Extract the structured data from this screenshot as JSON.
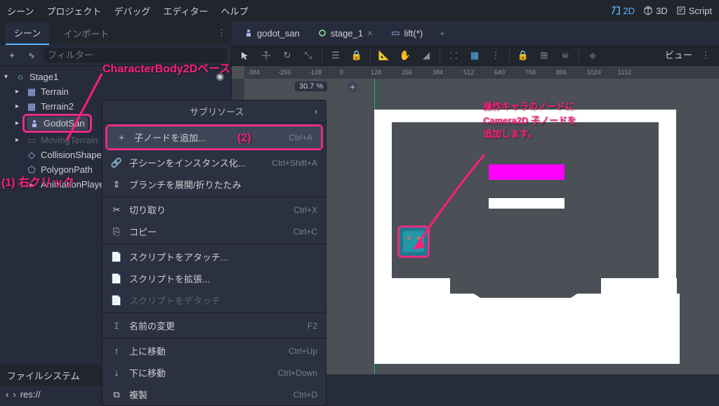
{
  "menubar": {
    "scene": "シーン",
    "project": "プロジェクト",
    "debug": "デバッグ",
    "editor": "エディター",
    "help": "ヘルプ",
    "mode_2d": "2D",
    "mode_3d": "3D",
    "mode_script": "Script"
  },
  "panel_tabs": {
    "scene": "シーン",
    "import": "インポート"
  },
  "scene_tabs": [
    {
      "label": "godot_san",
      "active": false
    },
    {
      "label": "stage_1",
      "active": true
    },
    {
      "label": "lift(*)",
      "active": false
    }
  ],
  "toolbar": {
    "filter_placeholder": "フィルター"
  },
  "tree": {
    "root": "Stage1",
    "children": [
      {
        "label": "Terrain",
        "icon": "tilemap"
      },
      {
        "label": "Terrain2",
        "icon": "tilemap"
      },
      {
        "label": "GodotSan",
        "icon": "body",
        "selected": true
      },
      {
        "label": "MovingTerrain",
        "icon": "body",
        "disabled": true
      },
      {
        "label": "CollisionShape2D",
        "icon": "collision"
      },
      {
        "label": "PolygonPath",
        "icon": "polygon"
      },
      {
        "label": "AnimationPlayer",
        "icon": "anim"
      }
    ]
  },
  "context_menu": {
    "header": "サブリソース",
    "add_child": "子ノードを追加...",
    "add_child_shortcut": "Ctrl+A",
    "instance_scene": "子シーンをインスタンス化...",
    "instance_scene_shortcut": "Ctrl+Shift+A",
    "expand_collapse": "ブランチを展開/折りたたみ",
    "cut": "切り取り",
    "cut_shortcut": "Ctrl+X",
    "copy": "コピー",
    "copy_shortcut": "Ctrl+C",
    "attach_script": "スクリプトをアタッチ...",
    "extend_script": "スクリプトを拡張...",
    "detach_script": "スクリプトをデタッチ",
    "rename": "名前の変更",
    "rename_shortcut": "F2",
    "move_up": "上に移動",
    "move_up_shortcut": "Ctrl+Up",
    "move_down": "下に移動",
    "move_down_shortcut": "Ctrl+Down",
    "duplicate": "複製",
    "duplicate_shortcut": "Ctrl+D"
  },
  "viewport": {
    "view_btn": "ビュー",
    "zoom": "30.7 %",
    "ruler_marks": [
      "-384",
      "-256",
      "-128",
      "0",
      "128",
      "256",
      "384",
      "512",
      "640",
      "768",
      "896",
      "1024",
      "1152"
    ]
  },
  "filesystem": {
    "header": "ファイルシステム",
    "res": "res://"
  },
  "annotations": {
    "base_class": "CharacterBody2Dベース",
    "step1": "(1) 右クリック",
    "step2": "(2)",
    "camera_note_l1": "操作キャラのノードに",
    "camera_note_l2": "Camera2D 子ノードを",
    "camera_note_l3": "追加します。"
  }
}
